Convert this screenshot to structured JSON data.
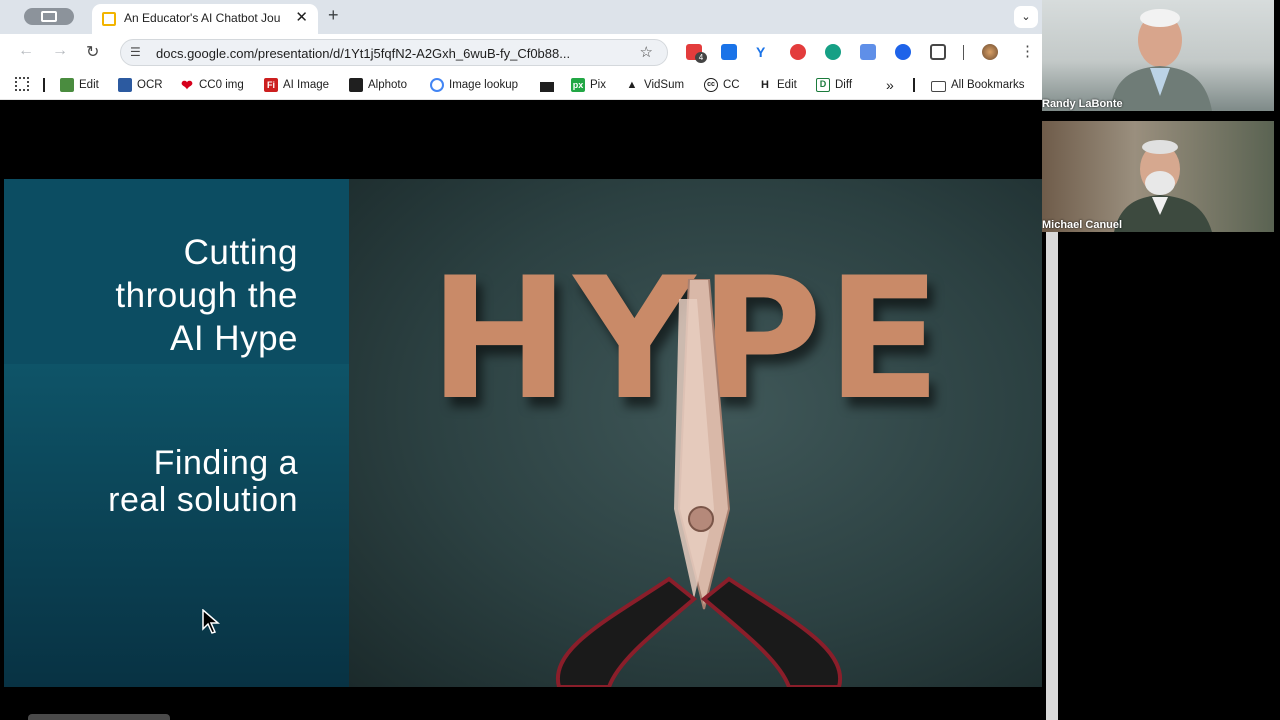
{
  "browser": {
    "tab": {
      "title": "An Educator's AI Chatbot Jou",
      "close": "✕"
    },
    "new_tab": "+",
    "tab_menu": "⌄",
    "url": "docs.google.com/presentation/d/1Yt1j5fqfN2-A2Gxh_6wuB-fy_Cf0b88...",
    "extension_badge": "4",
    "bookmarks": [
      {
        "label": "Edit",
        "icon": "grid-color-icon",
        "color": "#4a8c3f"
      },
      {
        "label": "OCR",
        "icon": "grid-blue-icon",
        "color": "#2c5aa0"
      },
      {
        "label": "CC0 img",
        "icon": "heart-icon",
        "color": "#d6001c"
      },
      {
        "label": "AI Image",
        "icon": "fi-icon",
        "color": "#cc1f1f"
      },
      {
        "label": "Alphoto",
        "icon": "camera-icon",
        "color": "#1f1f1f"
      },
      {
        "label": "Image lookup",
        "icon": "lens-icon",
        "color": "#4285f4"
      },
      {
        "label": "",
        "icon": "stack-icon",
        "color": "#1f1f1f"
      },
      {
        "label": "Pix",
        "icon": "px-icon",
        "color": "#22a745"
      },
      {
        "label": "VidSum",
        "icon": "triangle-icon",
        "color": "#1f1f1f"
      },
      {
        "label": "CC",
        "icon": "cc-icon",
        "color": "#1f1f1f"
      },
      {
        "label": "Edit",
        "icon": "h-icon",
        "color": "#1f1f1f"
      },
      {
        "label": "Diff",
        "icon": "d-icon",
        "color": "#1b7b3c"
      }
    ],
    "more_bookmarks": "»",
    "all_bookmarks": "All Bookmarks"
  },
  "slide": {
    "title": "Cutting\nthrough the\nAI Hype",
    "subtitle": "Finding a\nreal solution",
    "image_word": "HYPE"
  },
  "participants": [
    {
      "name": "Randy LaBonte"
    },
    {
      "name": "Michael Canuel"
    }
  ]
}
